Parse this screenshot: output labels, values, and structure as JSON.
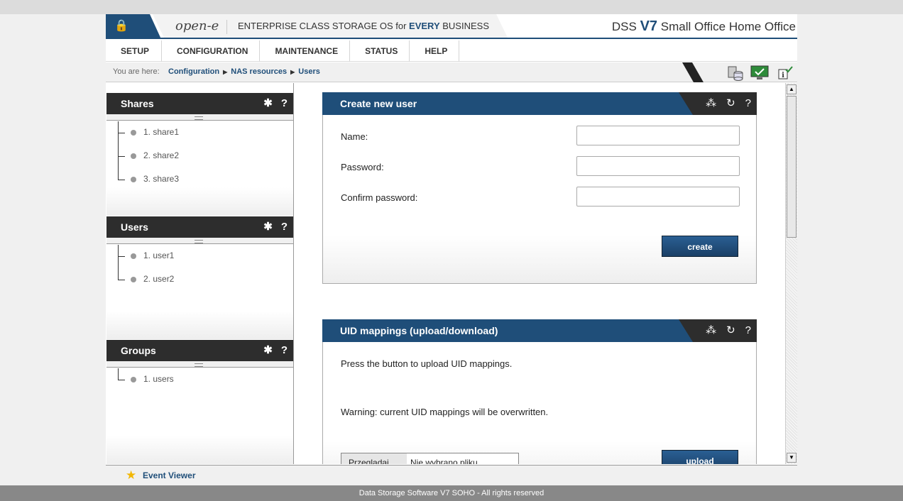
{
  "header": {
    "logo": "open-e",
    "tagline_pre": "ENTERPRISE CLASS STORAGE OS for ",
    "tagline_em": "EVERY",
    "tagline_post": " BUSINESS",
    "product_pre": "DSS ",
    "product_version": "V7",
    "product_post": " Small Office Home Office"
  },
  "menu": [
    "SETUP",
    "CONFIGURATION",
    "MAINTENANCE",
    "STATUS",
    "HELP"
  ],
  "breadcrumb": {
    "label": "You are here:",
    "items": [
      "Configuration",
      "NAS resources",
      "Users"
    ]
  },
  "panels": {
    "shares": {
      "title": "Shares",
      "items": [
        "1. share1",
        "2. share2",
        "3. share3"
      ]
    },
    "users": {
      "title": "Users",
      "items": [
        "1. user1",
        "2. user2"
      ]
    },
    "groups": {
      "title": "Groups",
      "items": [
        "1. users"
      ]
    }
  },
  "create_user": {
    "title": "Create new user",
    "name_label": "Name:",
    "password_label": "Password:",
    "confirm_label": "Confirm password:",
    "button": "create"
  },
  "uid": {
    "title": "UID mappings (upload/download)",
    "info": "Press the button to upload UID mappings.",
    "warning": "Warning: current UID mappings will be overwritten.",
    "browse_button": "Przeglądaj...",
    "file_status": "Nie wybrano pliku.",
    "button": "upload"
  },
  "event_viewer": "Event Viewer",
  "footer": "Data Storage Software V7 SOHO - All rights reserved",
  "colors": {
    "brand_blue": "#1f4e79",
    "dark_bar": "#2d2d2d"
  }
}
